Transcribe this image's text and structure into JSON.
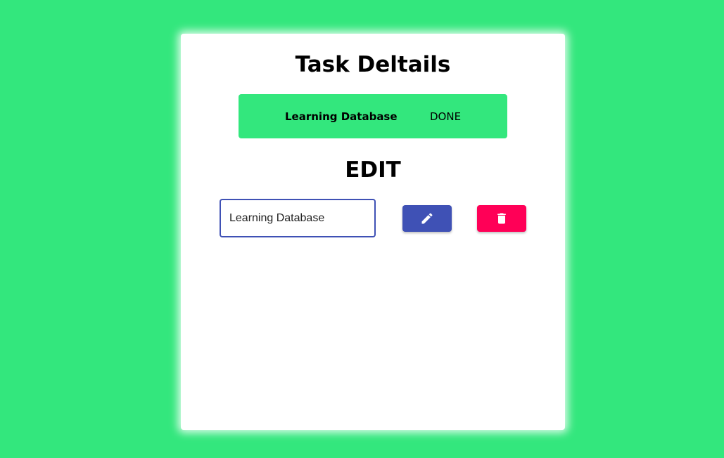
{
  "card": {
    "title": "Task Deltails",
    "edit_heading": "EDIT"
  },
  "task": {
    "name": "Learning Database",
    "status": "DONE"
  },
  "edit_form": {
    "input_value": "Learning Database",
    "edit_icon": "pencil-icon",
    "delete_icon": "trash-icon"
  },
  "colors": {
    "background": "#33e77d",
    "task_row": "#33e77d",
    "edit_button": "#3f51b5",
    "delete_button": "#ff0057",
    "input_border": "#3f51b5"
  }
}
